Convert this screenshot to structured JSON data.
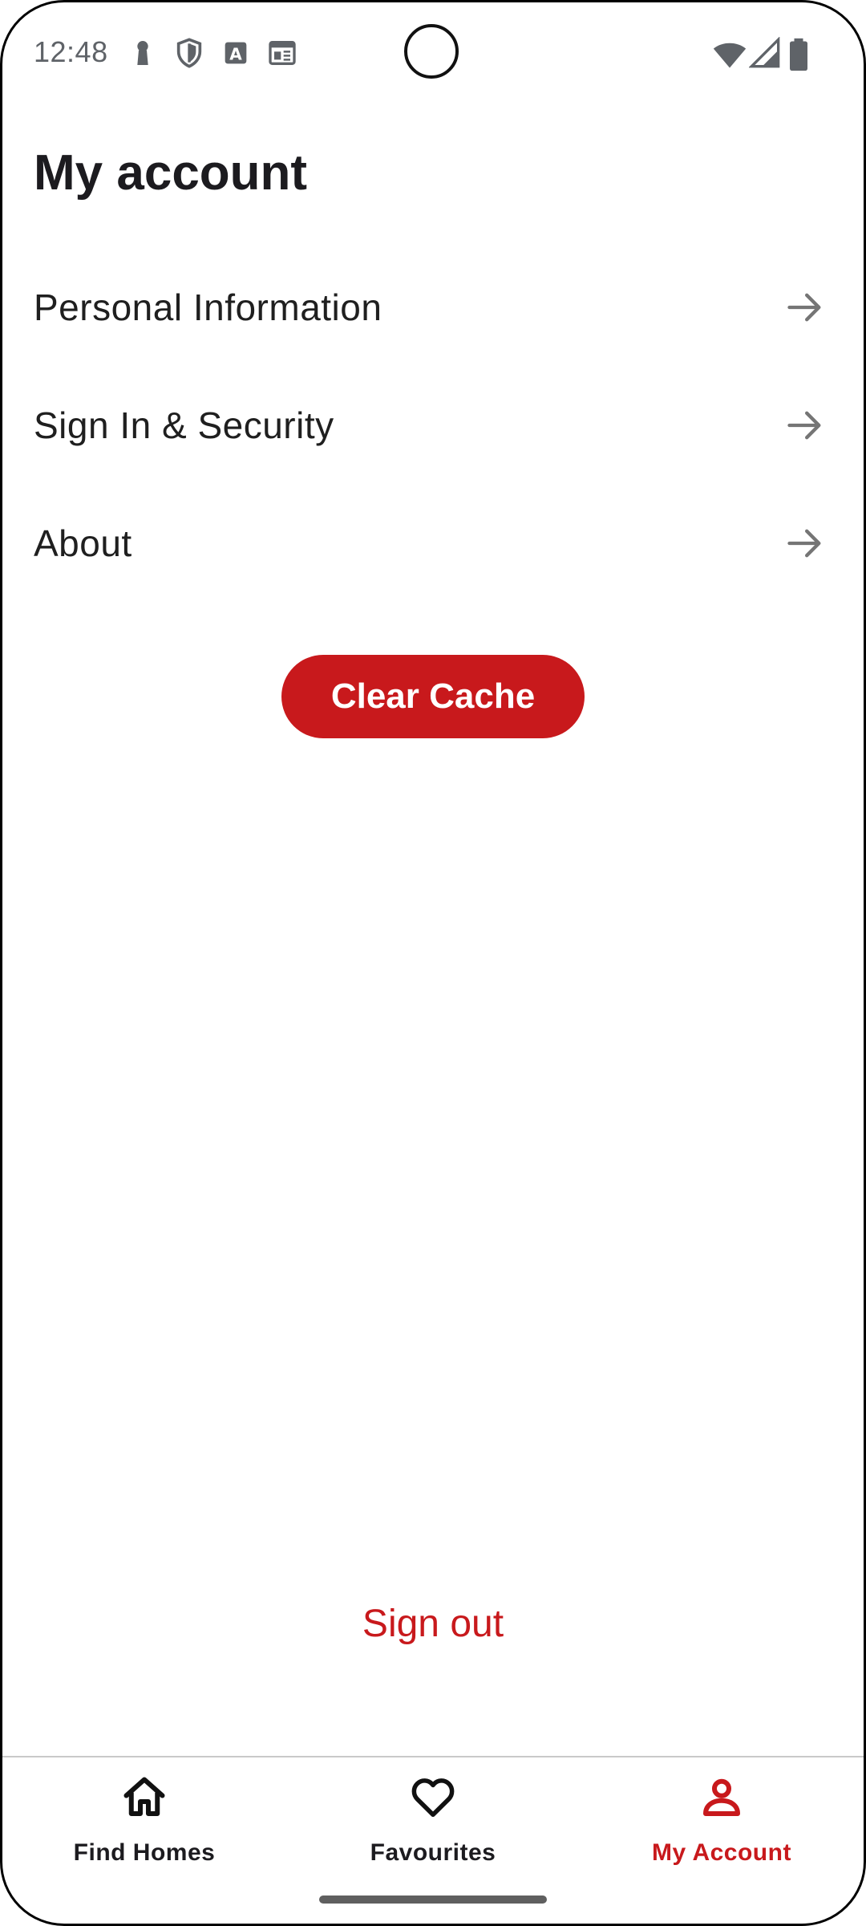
{
  "status_bar": {
    "time": "12:48",
    "icons_left": [
      "keyhole-icon",
      "shield-icon",
      "font-a-icon",
      "calendar-icon"
    ],
    "icons_right": [
      "wifi-icon",
      "cellular-signal-icon",
      "battery-icon"
    ]
  },
  "page": {
    "title": "My account"
  },
  "menu": {
    "items": [
      {
        "label": "Personal Information",
        "icon": "arrow-right-icon"
      },
      {
        "label": "Sign In & Security",
        "icon": "arrow-right-icon"
      },
      {
        "label": "About",
        "icon": "arrow-right-icon"
      }
    ]
  },
  "actions": {
    "clear_cache_label": "Clear Cache",
    "sign_out_label": "Sign out"
  },
  "bottom_nav": {
    "items": [
      {
        "label": "Find Homes",
        "icon": "home-icon",
        "active": false
      },
      {
        "label": "Favourites",
        "icon": "heart-icon",
        "active": false
      },
      {
        "label": "My Account",
        "icon": "person-icon",
        "active": true
      }
    ]
  },
  "colors": {
    "accent": "#c8191c",
    "text_primary": "#1f1f1f",
    "icon_grey": "#757575",
    "divider": "#c9c9c9"
  }
}
